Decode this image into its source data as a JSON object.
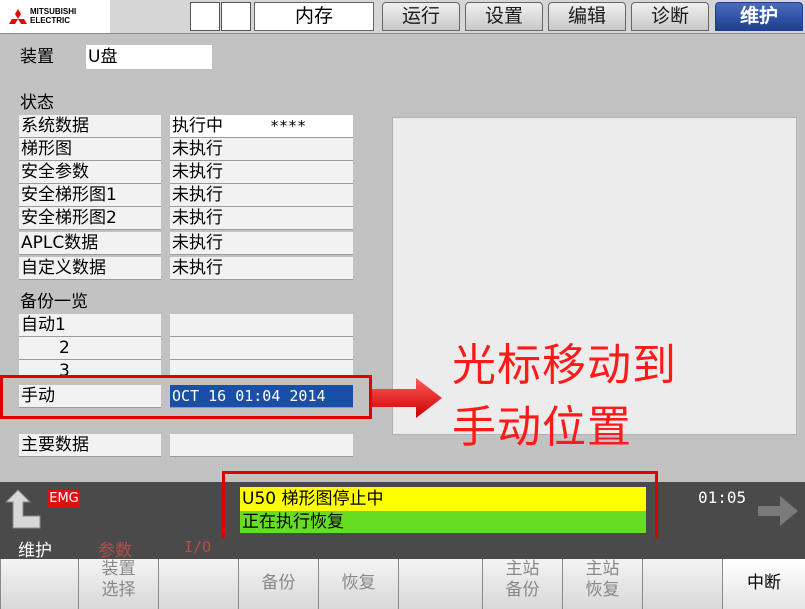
{
  "header": {
    "logo_text_line1": "MITSUBISHI",
    "logo_text_line2": "ELECTRIC",
    "memory_label": "内存",
    "tabs": [
      {
        "label": "运行"
      },
      {
        "label": "设置"
      },
      {
        "label": "编辑"
      },
      {
        "label": "诊断"
      },
      {
        "label": "维护",
        "active": true
      }
    ]
  },
  "device": {
    "label": "装置",
    "value": "U盘"
  },
  "status": {
    "heading": "状态",
    "rows": [
      {
        "name": "系统数据",
        "state": "执行中",
        "extra": "****"
      },
      {
        "name": "梯形图",
        "state": "未执行"
      },
      {
        "name": "安全参数",
        "state": "未执行"
      },
      {
        "name": "安全梯形图1",
        "state": "未执行"
      },
      {
        "name": "安全梯形图2",
        "state": "未执行"
      },
      {
        "name": "APLC数据",
        "state": "未执行"
      },
      {
        "name": "自定义数据",
        "state": "未执行"
      }
    ]
  },
  "backup": {
    "heading": "备份一览",
    "rows": [
      {
        "name": "自动1",
        "value": ""
      },
      {
        "name": "2",
        "value": ""
      },
      {
        "name": "3",
        "value": ""
      },
      {
        "name": "手动",
        "value": "OCT 16 01:04 2014"
      }
    ],
    "main_data_label": "主要数据"
  },
  "annotation": {
    "line1": "光标移动到",
    "line2": "手动位置"
  },
  "status_bar": {
    "emg": "EMG",
    "message1": "U50  梯形图停止中",
    "message2": "正在执行恢复",
    "clock": "01:05",
    "mode_labels": [
      "维护",
      "参数",
      "I/O"
    ]
  },
  "softkeys": [
    {
      "line1": "装置",
      "line2": "选择"
    },
    {
      "line1": "",
      "line2": ""
    },
    {
      "line1": "备份",
      "line2": ""
    },
    {
      "line1": "恢复",
      "line2": ""
    },
    {
      "line1": "",
      "line2": ""
    },
    {
      "line1": "主站",
      "line2": "备份"
    },
    {
      "line1": "主站",
      "line2": "恢复"
    },
    {
      "line1": "",
      "line2": ""
    },
    {
      "line1": "中断",
      "line2": "",
      "active": true
    }
  ],
  "colors": {
    "accent_tab": "#1e3f8f",
    "selection": "#1a4fa8",
    "annotation_red": "#ff1a1a",
    "message_yellow": "#ffff00",
    "message_green": "#66dd22"
  }
}
